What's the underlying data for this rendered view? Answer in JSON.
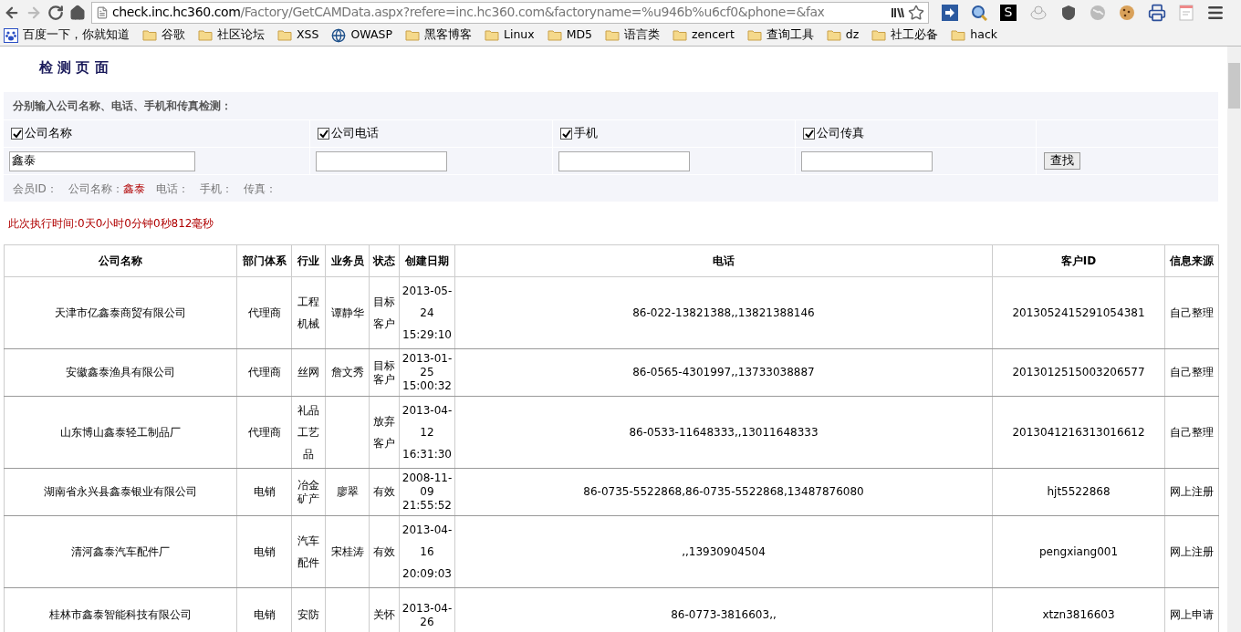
{
  "browser": {
    "url_host": "check.inc.hc360.com",
    "url_path": "/Factory/GetCAMData.aspx?refere=inc.hc360.com&factoryname=%u946b%u6cf0&phone=&fax",
    "bookmarks": [
      {
        "kind": "paw",
        "label": "百度一下，你就知道"
      },
      {
        "kind": "folder",
        "label": "谷歌"
      },
      {
        "kind": "folder",
        "label": "社区论坛"
      },
      {
        "kind": "folder",
        "label": "XSS"
      },
      {
        "kind": "globe",
        "label": "OWASP"
      },
      {
        "kind": "folder",
        "label": "黑客博客"
      },
      {
        "kind": "folder",
        "label": "Linux"
      },
      {
        "kind": "folder",
        "label": "MD5"
      },
      {
        "kind": "folder",
        "label": "语言类"
      },
      {
        "kind": "folder",
        "label": "zencert"
      },
      {
        "kind": "folder",
        "label": "查询工具"
      },
      {
        "kind": "folder",
        "label": "dz"
      },
      {
        "kind": "folder",
        "label": "社工必备"
      },
      {
        "kind": "folder",
        "label": "hack"
      }
    ],
    "extension_s": "S"
  },
  "page": {
    "title": "检 测 页 面",
    "form": {
      "instruction": "分别输入公司名称、电话、手机和传真检测：",
      "fields": [
        {
          "label": "公司名称",
          "checked": true,
          "value": "鑫泰"
        },
        {
          "label": "公司电话",
          "checked": true
        },
        {
          "label": "手机",
          "checked": true
        },
        {
          "label": "公司传真",
          "checked": true
        }
      ],
      "button": "查找",
      "summary": [
        {
          "label": "会员ID："
        },
        {
          "label": "公司名称：",
          "value": "鑫泰"
        },
        {
          "label": "电话："
        },
        {
          "label": "手机："
        },
        {
          "label": "传真："
        }
      ]
    },
    "timing": "此次执行时间:0天0小时0分钟0秒812毫秒",
    "table": {
      "columns": [
        "公司名称",
        "部门体系",
        "行业",
        "业务员",
        "状态",
        "创建日期",
        "电话",
        "客户ID",
        "信息来源"
      ],
      "rows": [
        [
          "天津市亿鑫泰商贸有限公司",
          "代理商",
          "工程机械",
          "谭静华",
          "目标客户",
          "2013-05-24 15:29:10",
          "86-022-13821388,,13821388146",
          "2013052415291054381",
          "自己整理"
        ],
        [
          "安徽鑫泰渔具有限公司",
          "代理商",
          "丝网",
          "詹文秀",
          "目标客户",
          "2013-01-25 15:00:32",
          "86-0565-4301997,,13733038887",
          "2013012515003206577",
          "自己整理"
        ],
        [
          "山东博山鑫泰轻工制品厂",
          "代理商",
          "礼品工艺品",
          "",
          "放弃客户",
          "2013-04-12 16:31:30",
          "86-0533-11648333,,13011648333",
          "2013041216313016612",
          "自己整理"
        ],
        [
          "湖南省永兴县鑫泰银业有限公司",
          "电销",
          "冶金矿产",
          "廖翠",
          "有效",
          "2008-11-09 21:55:52",
          "86-0735-5522868,86-0735-5522868,13487876080",
          "hjt5522868",
          "网上注册"
        ],
        [
          "清河鑫泰汽车配件厂",
          "电销",
          "汽车配件",
          "宋桂涛",
          "有效",
          "2013-04-16 20:09:03",
          ",,13930904504",
          "pengxiang001",
          "网上注册"
        ],
        [
          "桂林市鑫泰智能科技有限公司",
          "电销",
          "安防",
          "",
          "关怀",
          "2013-04-26",
          "86-0773-3816603,,",
          "xtzn3816603",
          "网上申请"
        ]
      ]
    }
  }
}
